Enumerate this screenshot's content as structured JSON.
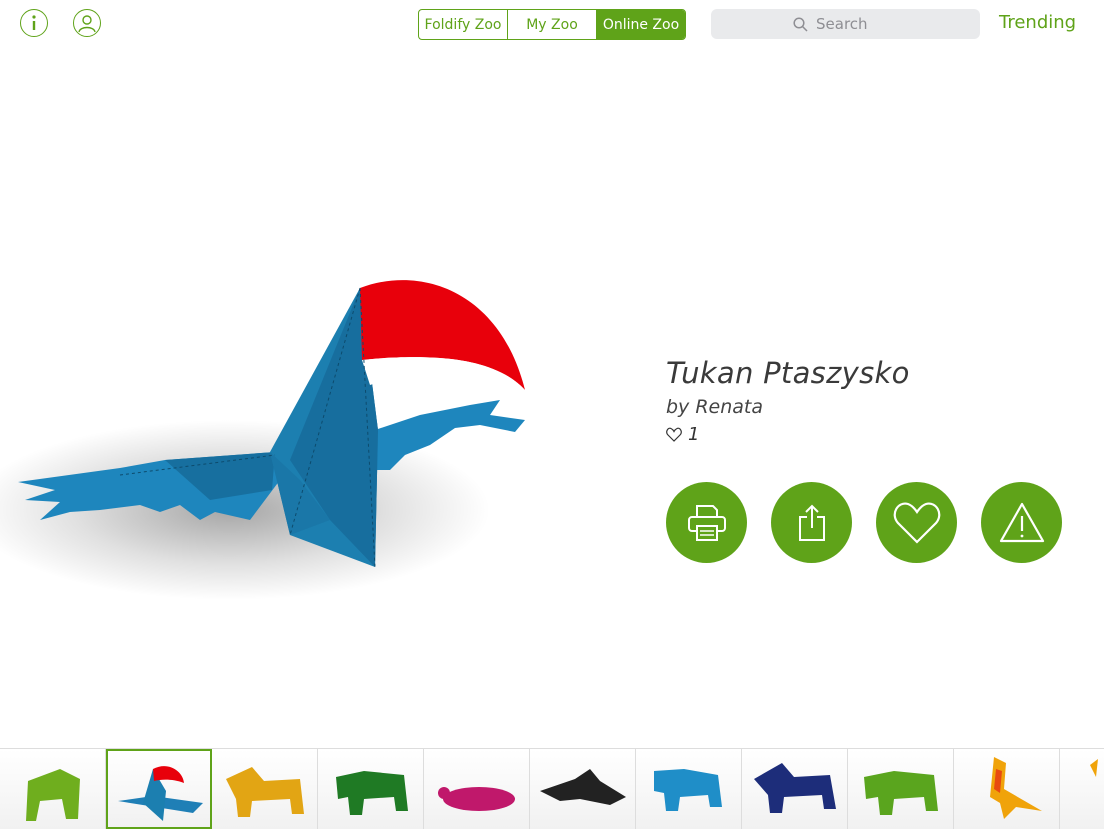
{
  "header": {
    "info_icon": "info-icon",
    "account_icon": "user-icon",
    "tabs": [
      {
        "label": "Foldify Zoo",
        "active": false
      },
      {
        "label": "My Zoo",
        "active": false
      },
      {
        "label": "Online Zoo",
        "active": true
      }
    ],
    "search": {
      "placeholder": "Search",
      "icon": "search-icon"
    },
    "trending_label": "Trending"
  },
  "model": {
    "title": "Tukan Ptaszysko",
    "author": "by Renata",
    "likes": "1"
  },
  "actions": [
    {
      "name": "print",
      "icon": "printer-icon"
    },
    {
      "name": "share",
      "icon": "share-icon"
    },
    {
      "name": "favorite",
      "icon": "heart-icon"
    },
    {
      "name": "report",
      "icon": "warning-icon"
    }
  ],
  "thumbnails": [
    {
      "subject": "green gorilla",
      "color": "#6fae1e"
    },
    {
      "subject": "toucan",
      "color": "#1f7fb6",
      "selected": true
    },
    {
      "subject": "yellow rhino",
      "color": "#e2a514"
    },
    {
      "subject": "green elephant",
      "color": "#1f7a24"
    },
    {
      "subject": "magenta turtle",
      "color": "#c0186b"
    },
    {
      "subject": "black bird",
      "color": "#222222"
    },
    {
      "subject": "blue elephant",
      "color": "#1f8ec8"
    },
    {
      "subject": "navy rhino",
      "color": "#1d2d7a"
    },
    {
      "subject": "green elephant",
      "color": "#5aa51e"
    },
    {
      "subject": "patterned bird",
      "color": "#f0a30a"
    },
    {
      "subject": "partial",
      "color": "#f0a30a"
    }
  ],
  "colors": {
    "accent": "#5fa319",
    "beak": "#e8000b",
    "body": "#1c7fb0"
  }
}
